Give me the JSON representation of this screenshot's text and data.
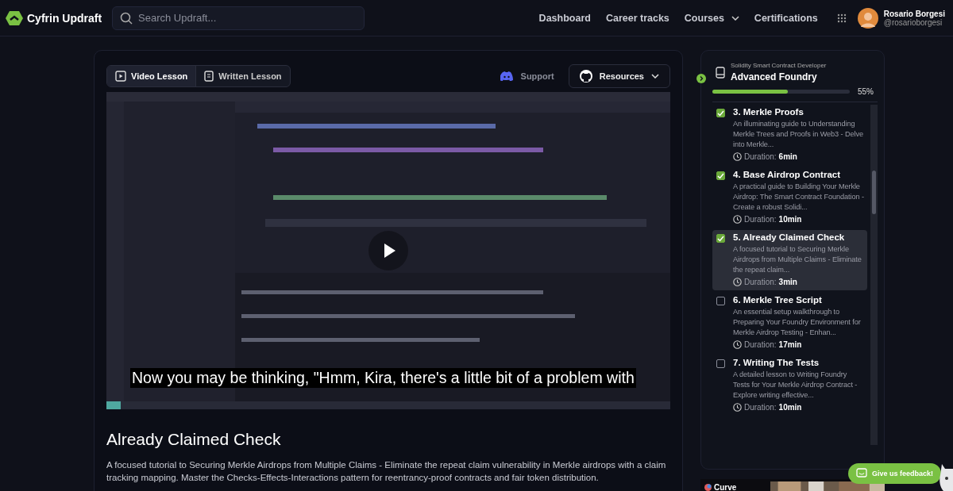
{
  "header": {
    "brand": "Cyfrin Updraft",
    "search": {
      "placeholder": "Search Updraft..."
    },
    "nav": [
      {
        "label": "Dashboard",
        "kind": "link"
      },
      {
        "label": "Career tracks",
        "kind": "link"
      },
      {
        "label": "Courses",
        "kind": "dropdown"
      },
      {
        "label": "Certifications",
        "kind": "link"
      }
    ],
    "user": {
      "name": "Rosario Borgesi",
      "handle": "@rosarioborgesi"
    }
  },
  "lesson": {
    "tabs": [
      {
        "label": "Video Lesson",
        "kind": "video",
        "selected": true
      },
      {
        "label": "Written Lesson",
        "kind": "written",
        "selected": false
      }
    ],
    "support": "Support",
    "resources": "Resources",
    "video": {
      "kind": "picture",
      "caption": "Now you may be thinking, \"Hmm, Kira, there's a little bit of a problem with"
    },
    "title": "Already Claimed Check",
    "description": "A focused tutorial to Securing Merkle Airdrops from Multiple Claims - Eliminate the repeat claim vulnerability in Merkle airdrops with a claim tracking mapping. Master the Checks-Effects-Interactions pattern for reentrancy-proof contracts and fair token distribution."
  },
  "course": {
    "track": "Solidity Smart Contract Developer",
    "title": "Advanced Foundry",
    "level": 0.55,
    "percent": "55%",
    "lessons": [
      {
        "title": "3. Merkle Proofs",
        "summary": "An illuminating guide to Understanding Merkle Trees and Proofs in Web3 - Delve into Merkle...",
        "duration_label": "Duration:",
        "duration": "6min",
        "checked": true,
        "selected": false
      },
      {
        "title": "4. Base Airdrop Contract",
        "summary": "A practical guide to Building Your Merkle Airdrop: The Smart Contract Foundation - Create a robust Solidi...",
        "duration_label": "Duration:",
        "duration": "10min",
        "checked": true,
        "selected": false
      },
      {
        "title": "5. Already Claimed Check",
        "summary": "A focused tutorial to Securing Merkle Airdrops from Multiple Claims - Eliminate the repeat claim...",
        "duration_label": "Duration:",
        "duration": "3min",
        "checked": true,
        "selected": true
      },
      {
        "title": "6. Merkle Tree Script",
        "summary": "An essential setup walkthrough to Preparing Your Foundry Environment for Merkle Airdrop Testing - Enhan...",
        "duration_label": "Duration:",
        "duration": "17min",
        "checked": false,
        "selected": false
      },
      {
        "title": "7. Writing The Tests",
        "summary": "A detailed lesson to Writing Foundry Tests for Your Merkle Airdrop Contract - Explore writing effective...",
        "duration_label": "Duration:",
        "duration": "10min",
        "checked": false,
        "selected": false
      }
    ]
  },
  "ad": {
    "brand": "Curve"
  },
  "feedback": "Give us feedback!"
}
